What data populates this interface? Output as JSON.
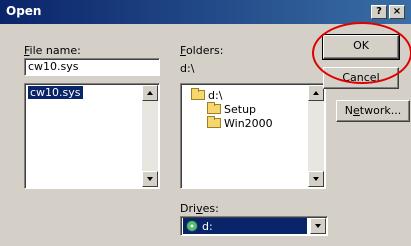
{
  "window": {
    "title": "Open",
    "help_glyph": "?",
    "close_glyph": "×"
  },
  "file_name": {
    "label_prefix": "",
    "label_accel": "F",
    "label_rest": "ile name:",
    "value": "cw10.sys",
    "list_items": [
      "cw10.sys"
    ]
  },
  "folders": {
    "label_accel": "F",
    "label_rest": "olders:",
    "current_path": "d:\\",
    "tree": [
      {
        "name": "d:\\",
        "type": "open-folder"
      },
      {
        "name": "Setup",
        "type": "folder"
      },
      {
        "name": "Win2000",
        "type": "folder"
      }
    ]
  },
  "drives": {
    "label_pre": "Dri",
    "label_accel": "v",
    "label_rest": "es:",
    "selected": "d:"
  },
  "buttons": {
    "ok": "OK",
    "cancel": "Cancel",
    "network_pre": "N",
    "network_accel": "e",
    "network_rest": "twork..."
  },
  "colors": {
    "title_bar": "#0a246a",
    "highlight": "#0a246a",
    "annotation_circle": "#e00000"
  }
}
